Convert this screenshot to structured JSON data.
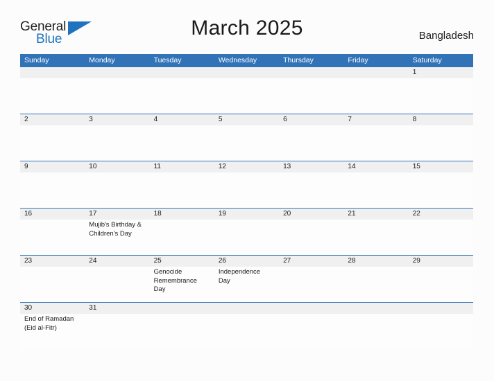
{
  "brand": {
    "name_part1": "General",
    "name_part2": "Blue",
    "flag_icon": "blue-triangle-flag",
    "accent_color": "#1f72bd"
  },
  "header": {
    "title": "March 2025",
    "country": "Bangladesh"
  },
  "calendar": {
    "header_color": "#3273b8",
    "row_band_color": "#f0f0f0",
    "weekdays": [
      "Sunday",
      "Monday",
      "Tuesday",
      "Wednesday",
      "Thursday",
      "Friday",
      "Saturday"
    ],
    "weeks": [
      {
        "days": [
          {
            "num": "",
            "events": []
          },
          {
            "num": "",
            "events": []
          },
          {
            "num": "",
            "events": []
          },
          {
            "num": "",
            "events": []
          },
          {
            "num": "",
            "events": []
          },
          {
            "num": "",
            "events": []
          },
          {
            "num": "1",
            "events": []
          }
        ]
      },
      {
        "days": [
          {
            "num": "2",
            "events": []
          },
          {
            "num": "3",
            "events": []
          },
          {
            "num": "4",
            "events": []
          },
          {
            "num": "5",
            "events": []
          },
          {
            "num": "6",
            "events": []
          },
          {
            "num": "7",
            "events": []
          },
          {
            "num": "8",
            "events": []
          }
        ]
      },
      {
        "days": [
          {
            "num": "9",
            "events": []
          },
          {
            "num": "10",
            "events": []
          },
          {
            "num": "11",
            "events": []
          },
          {
            "num": "12",
            "events": []
          },
          {
            "num": "13",
            "events": []
          },
          {
            "num": "14",
            "events": []
          },
          {
            "num": "15",
            "events": []
          }
        ]
      },
      {
        "days": [
          {
            "num": "16",
            "events": []
          },
          {
            "num": "17",
            "events": [
              "Mujib's Birthday &",
              "Children's Day"
            ]
          },
          {
            "num": "18",
            "events": []
          },
          {
            "num": "19",
            "events": []
          },
          {
            "num": "20",
            "events": []
          },
          {
            "num": "21",
            "events": []
          },
          {
            "num": "22",
            "events": []
          }
        ]
      },
      {
        "days": [
          {
            "num": "23",
            "events": []
          },
          {
            "num": "24",
            "events": []
          },
          {
            "num": "25",
            "events": [
              "Genocide",
              "Remembrance Day"
            ]
          },
          {
            "num": "26",
            "events": [
              "Independence Day"
            ]
          },
          {
            "num": "27",
            "events": []
          },
          {
            "num": "28",
            "events": []
          },
          {
            "num": "29",
            "events": []
          }
        ]
      },
      {
        "days": [
          {
            "num": "30",
            "events": [
              "End of Ramadan",
              "(Eid al-Fitr)"
            ]
          },
          {
            "num": "31",
            "events": []
          },
          {
            "num": "",
            "events": []
          },
          {
            "num": "",
            "events": []
          },
          {
            "num": "",
            "events": []
          },
          {
            "num": "",
            "events": []
          },
          {
            "num": "",
            "events": []
          }
        ]
      }
    ]
  }
}
